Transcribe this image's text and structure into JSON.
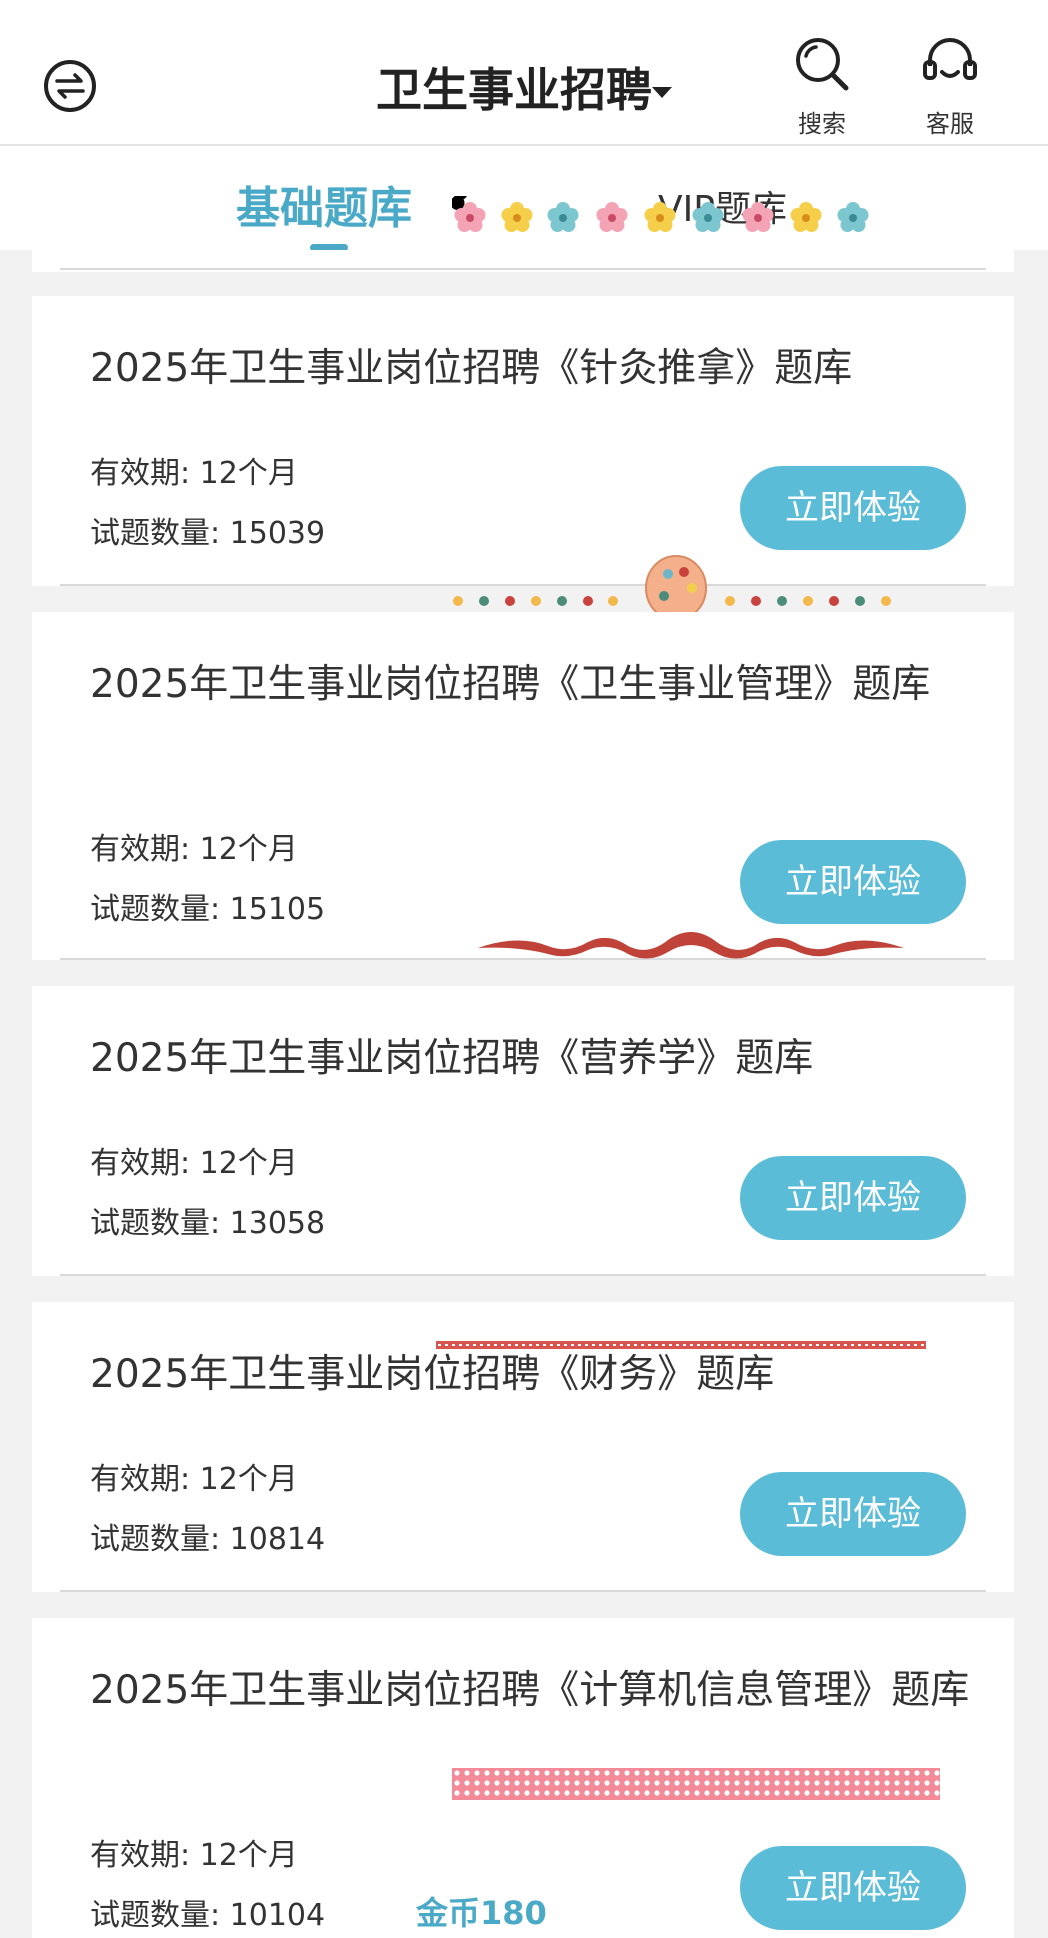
{
  "header": {
    "title": "卫生事业招聘",
    "search_label": "搜索",
    "service_label": "客服"
  },
  "tabs": [
    {
      "label": "基础题库",
      "active": true
    },
    {
      "label": "VIP题库",
      "active": false
    }
  ],
  "cards": [
    {
      "title": "2025年卫生事业岗位招聘《针灸推拿》题库",
      "validity": "有效期: 12个月",
      "count": "试题数量: 15039",
      "button": "立即体验"
    },
    {
      "title": "2025年卫生事业岗位招聘《卫生事业管理》题库",
      "validity": "有效期: 12个月",
      "count": "试题数量: 15105",
      "button": "立即体验"
    },
    {
      "title": "2025年卫生事业岗位招聘《营养学》题库",
      "validity": "有效期: 12个月",
      "count": "试题数量: 13058",
      "button": "立即体验"
    },
    {
      "title": "2025年卫生事业岗位招聘《财务》题库",
      "validity": "有效期: 12个月",
      "count": "试题数量: 10814",
      "button": "立即体验"
    },
    {
      "title": "2025年卫生事业岗位招聘《计算机信息管理》题库",
      "validity": "有效期: 12个月",
      "count": "试题数量: 10104",
      "button": "立即体验",
      "coins": "金币180"
    }
  ],
  "colors": {
    "accent": "#4aa9c7",
    "button": "#5bbcd8"
  },
  "icons": [
    "switch-icon",
    "search-icon",
    "headset-icon",
    "caret-down-icon"
  ]
}
